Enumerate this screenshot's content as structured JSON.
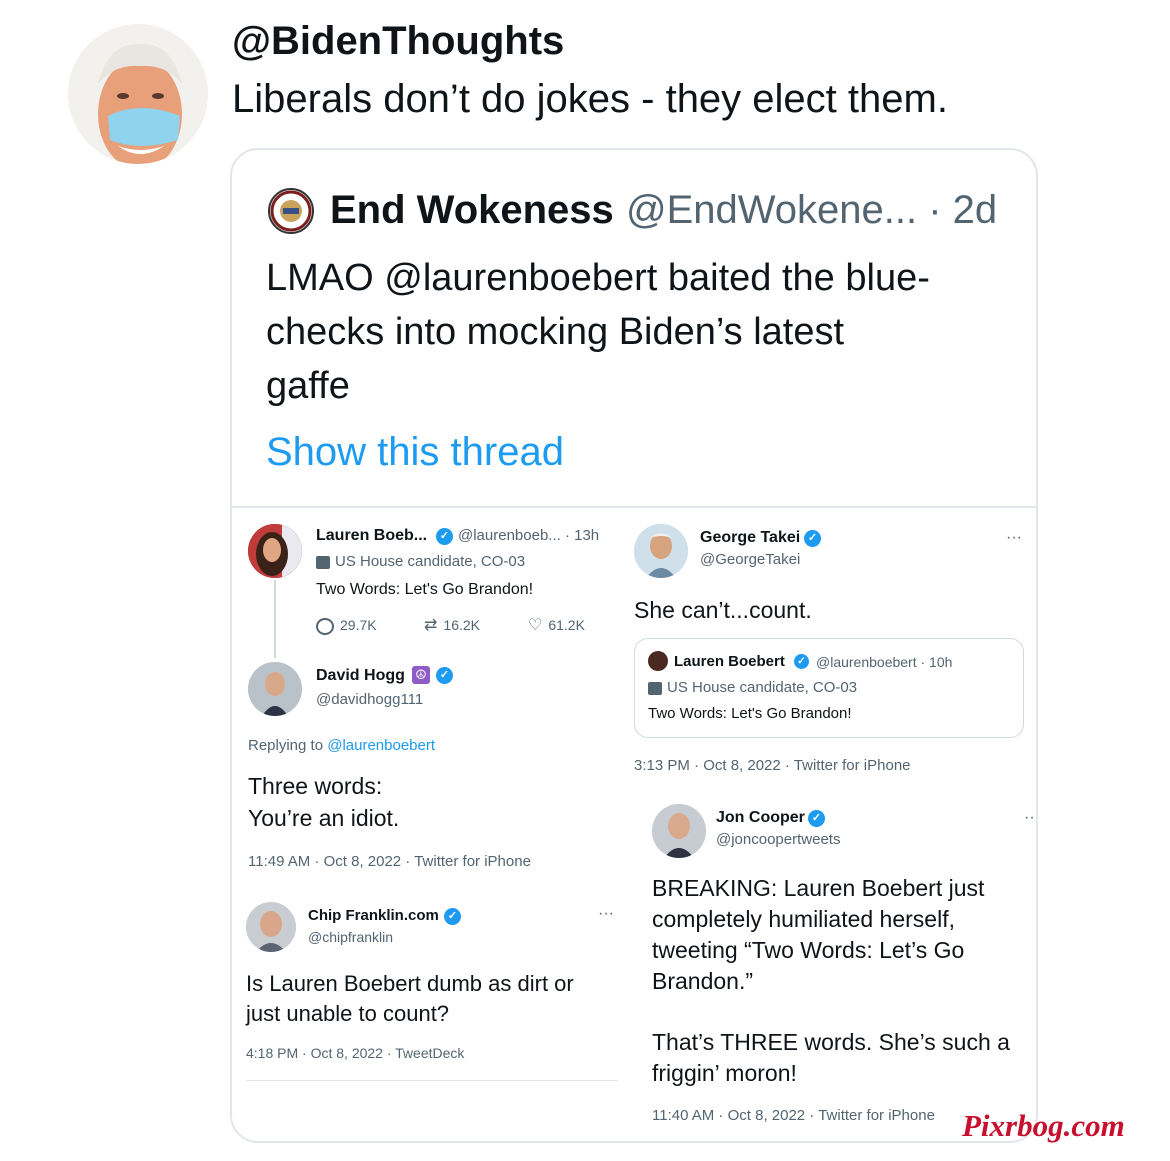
{
  "main_tweet": {
    "handle": "@BidenThoughts",
    "text": "Liberals don’t do jokes - they elect them."
  },
  "quoted": {
    "name": "End Wokeness",
    "handle_time": "@EndWokene... · 2d",
    "text_line1": "LMAO @laurenboebert baited the blue-",
    "text_line2": "checks into mocking Biden’s latest",
    "text_line3": "gaffe",
    "show_thread": "Show this thread"
  },
  "left_col": {
    "boebert": {
      "name": "Lauren Boeb...",
      "handle_time": "@laurenboeb... · 13h",
      "affiliation": "US House candidate, CO-03",
      "text": "Two Words: Let's Go Brandon!",
      "replies": "29.7K",
      "retweets": "16.2K",
      "likes": "61.2K"
    },
    "hogg": {
      "name": "David Hogg",
      "handle": "@davidhogg111",
      "replying_prefix": "Replying to",
      "replying_to": "@laurenboebert",
      "text_line1": "Three words:",
      "text_line2": "You’re an idiot.",
      "meta": "11:49 AM · Oct 8, 2022 · Twitter for iPhone"
    },
    "franklin": {
      "name": "Chip Franklin.com",
      "handle": "@chipfranklin",
      "more": "···",
      "text_line1": "Is Lauren Boebert dumb as dirt or",
      "text_line2": "just unable to count?",
      "meta": "4:18 PM · Oct 8, 2022 · TweetDeck"
    }
  },
  "right_col": {
    "takei": {
      "name": "George Takei",
      "handle": "@GeorgeTakei",
      "more": "···",
      "text": "She can’t...count.",
      "quote_name": "Lauren Boebert",
      "quote_handle_time": "@laurenboebert · 10h",
      "quote_affiliation": "US House candidate, CO-03",
      "quote_text": "Two Words: Let's Go Brandon!",
      "meta": "3:13 PM · Oct 8, 2022 · Twitter for iPhone"
    },
    "cooper": {
      "name": "Jon Cooper",
      "handle": "@joncoopertweets",
      "more": "··",
      "text_line1": "BREAKING: Lauren Boebert just",
      "text_line2": "completely humiliated herself,",
      "text_line3": "tweeting “Two Words: Let’s Go",
      "text_line4": "Brandon.”",
      "text_line5": "That’s THREE words. She’s such a",
      "text_line6": "friggin’ moron!",
      "meta": "11:40 AM · Oct 8, 2022 · Twitter for iPhone"
    }
  },
  "watermark": "Pixrbog.com",
  "colors": {
    "twitter_blue": "#1d9bf0",
    "grey_text": "#536471",
    "border": "#cfd9de",
    "watermark_red": "#c8102e"
  },
  "icons": [
    "verified-badge-icon",
    "building-icon",
    "reply-icon",
    "retweet-icon",
    "like-icon",
    "more-icon",
    "peace-icon"
  ]
}
